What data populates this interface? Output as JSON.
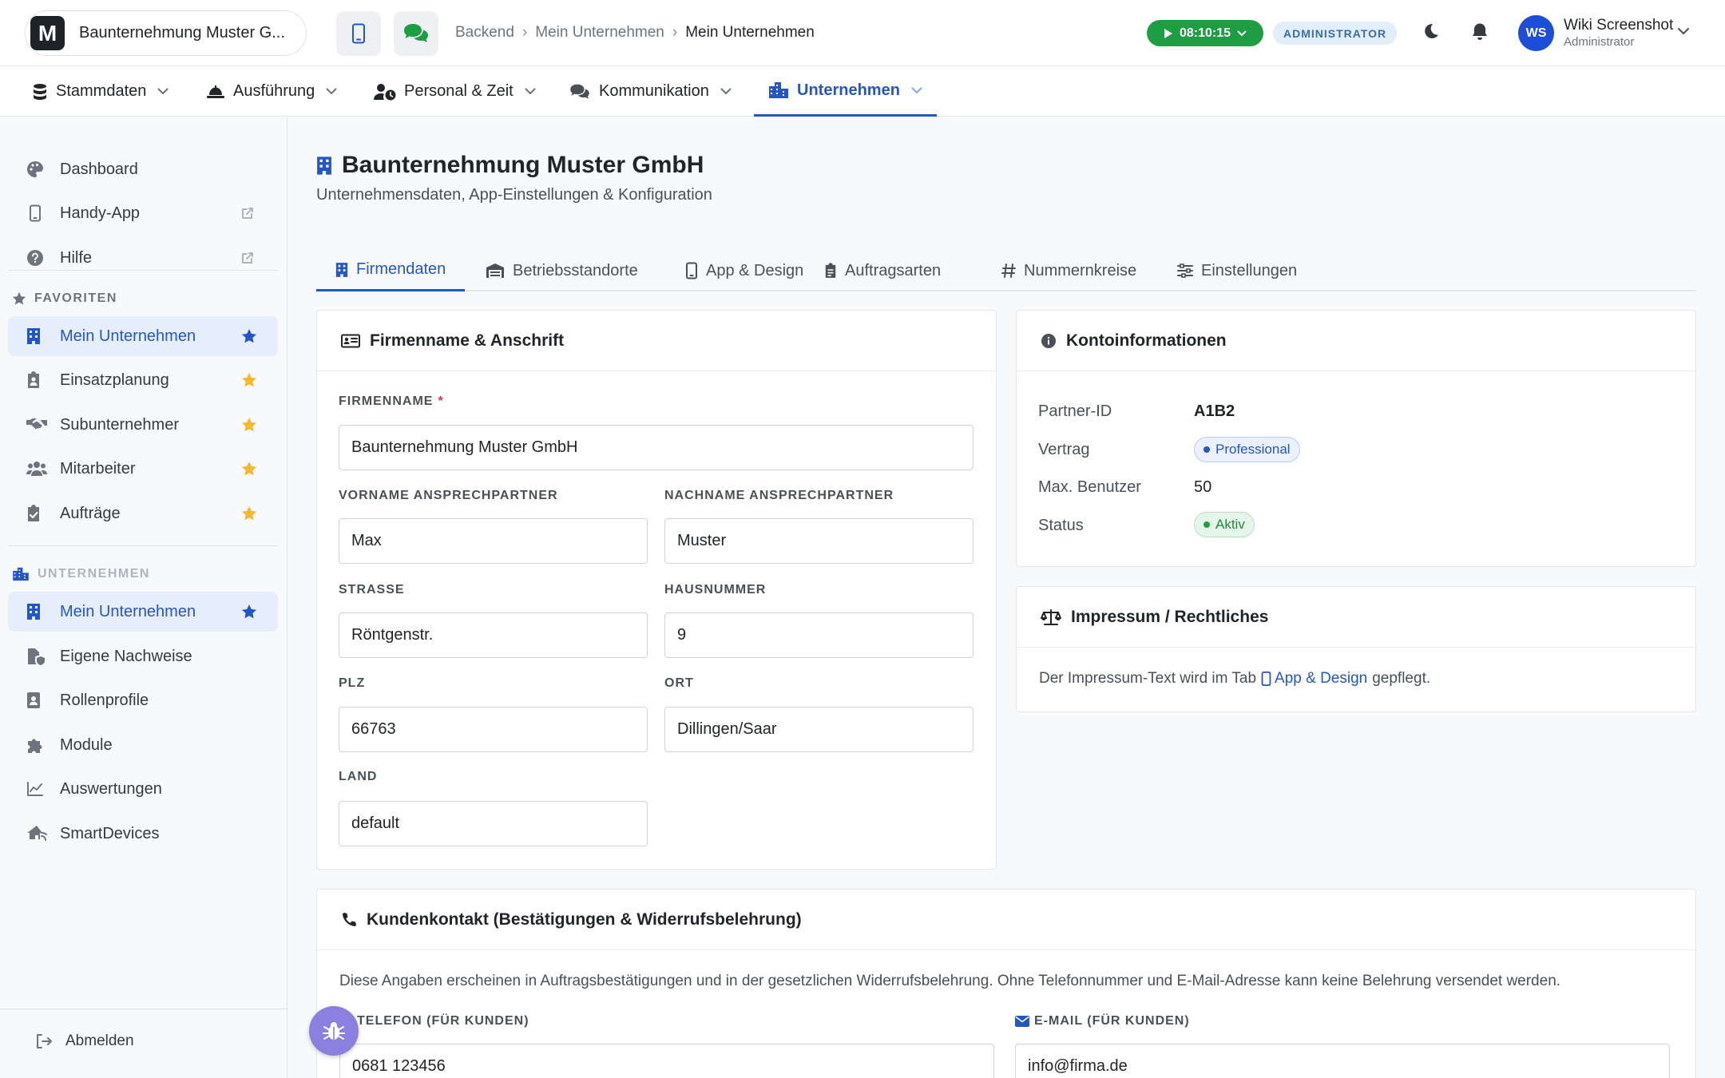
{
  "header": {
    "company_name": "Baunternehmung Muster G...",
    "logo_letter": "M",
    "breadcrumb": [
      "Backend",
      "Mein Unternehmen",
      "Mein Unternehmen"
    ],
    "timer": "08:10:15",
    "role_badge": "ADMINISTRATOR",
    "avatar_initials": "WS",
    "user_name": "Wiki Screenshot",
    "user_role": "Administrator"
  },
  "nav": {
    "items": [
      {
        "label": "Stammdaten",
        "icon": "database-icon"
      },
      {
        "label": "Ausführung",
        "icon": "hard-hat-icon"
      },
      {
        "label": "Personal & Zeit",
        "icon": "user-clock-icon"
      },
      {
        "label": "Kommunikation",
        "icon": "comments-icon"
      },
      {
        "label": "Unternehmen",
        "icon": "city-icon",
        "active": true
      }
    ]
  },
  "sidebar": {
    "top_items": [
      {
        "label": "Dashboard",
        "icon": "palette-icon"
      },
      {
        "label": "Handy-App",
        "icon": "mobile-icon"
      },
      {
        "label": "Hilfe",
        "icon": "question-circle-icon"
      }
    ],
    "favorites_title": "FAVORITEN",
    "favorites": [
      {
        "label": "Mein Unternehmen",
        "icon": "building-icon"
      },
      {
        "label": "Einsatzplanung",
        "icon": "clipboard-user-icon"
      },
      {
        "label": "Subunternehmer",
        "icon": "handshake-icon"
      },
      {
        "label": "Mitarbeiter",
        "icon": "users-icon"
      },
      {
        "label": "Aufträge",
        "icon": "clipboard-check-icon"
      }
    ],
    "section_title": "UNTERNEHMEN",
    "section_items": [
      {
        "label": "Mein Unternehmen",
        "icon": "building-icon"
      },
      {
        "label": "Eigene Nachweise",
        "icon": "file-shield-icon"
      },
      {
        "label": "Rollenprofile",
        "icon": "id-badge-icon"
      },
      {
        "label": "Module",
        "icon": "puzzle-icon"
      },
      {
        "label": "Auswertungen",
        "icon": "chart-line-icon"
      },
      {
        "label": "SmartDevices",
        "icon": "house-signal-icon"
      }
    ],
    "logout_label": "Abmelden"
  },
  "page": {
    "title": "Baunternehmung Muster GmbH",
    "subtitle": "Unternehmensdaten, App-Einstellungen & Konfiguration"
  },
  "tabs": [
    {
      "label": "Firmendaten",
      "icon": "building-icon",
      "active": true
    },
    {
      "label": "Betriebsstandorte",
      "icon": "warehouse-icon"
    },
    {
      "label": "App & Design",
      "icon": "mobile-icon"
    },
    {
      "label": "Auftragsarten",
      "icon": "clipboard-icon"
    },
    {
      "label": "Nummernkreise",
      "icon": "hashtag-icon"
    },
    {
      "label": "Einstellungen",
      "icon": "sliders-icon"
    }
  ],
  "firma_card": {
    "title": "Firmenname & Anschrift",
    "required_mark": "*",
    "fields": {
      "firmenname": {
        "label": "FIRMENNAME",
        "value": "Baunternehmung Muster GmbH"
      },
      "vorname": {
        "label": "VORNAME ANSPRECHPARTNER",
        "value": "Max"
      },
      "nachname": {
        "label": "NACHNAME ANSPRECHPARTNER",
        "value": "Muster"
      },
      "strasse": {
        "label": "STRASSE",
        "value": "Röntgenstr."
      },
      "hausnummer": {
        "label": "HAUSNUMMER",
        "value": "9"
      },
      "plz": {
        "label": "PLZ",
        "value": "66763"
      },
      "ort": {
        "label": "ORT",
        "value": "Dillingen/Saar"
      },
      "land": {
        "label": "LAND",
        "value": "default"
      }
    }
  },
  "konto_card": {
    "title": "Kontoinformationen",
    "partner_label": "Partner-ID",
    "partner_value": "A1B2",
    "vertrag_label": "Vertrag",
    "vertrag_value": "Professional",
    "max_label": "Max. Benutzer",
    "max_value": "50",
    "status_label": "Status",
    "status_value": "Aktiv"
  },
  "impressum_card": {
    "title": "Impressum / Rechtliches",
    "text_before": "Der Impressum-Text wird im Tab",
    "link": "App & Design",
    "text_after": "gepflegt."
  },
  "kunden_card": {
    "title": "Kundenkontakt (Bestätigungen & Widerrufsbelehrung)",
    "description": "Diese Angaben erscheinen in Auftragsbestätigungen und in der gesetzlichen Widerrufsbelehrung. Ohne Telefonnummer und E-Mail-Adresse kann keine Belehrung versendet werden.",
    "telefon_label": "TELEFON (FÜR KUNDEN)",
    "telefon_value": "0681 123456",
    "email_label": "E-MAIL (FÜR KUNDEN)",
    "email_value": "info@firma.de"
  },
  "colors": {
    "accent": "#2556c5",
    "success": "#1f9d43",
    "favorite_star": "#f5b82e",
    "fab": "#8b7fe0"
  }
}
